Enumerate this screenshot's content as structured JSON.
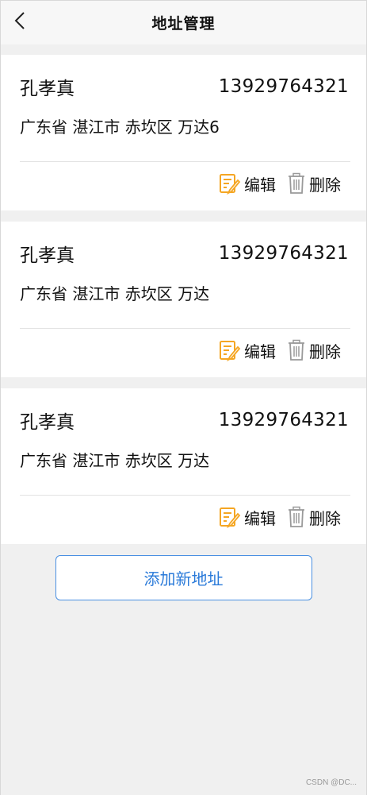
{
  "header": {
    "title": "地址管理",
    "back_icon": "chevron-left-icon"
  },
  "addresses": [
    {
      "name": "孔孝真",
      "phone": "13929764321",
      "address": "广东省 湛江市 赤坎区 万达6",
      "edit_label": "编辑",
      "delete_label": "删除"
    },
    {
      "name": "孔孝真",
      "phone": "13929764321",
      "address": "广东省 湛江市 赤坎区 万达",
      "edit_label": "编辑",
      "delete_label": "删除"
    },
    {
      "name": "孔孝真",
      "phone": "13929764321",
      "address": "广东省 湛江市 赤坎区 万达",
      "edit_label": "编辑",
      "delete_label": "删除"
    }
  ],
  "add_button": {
    "label": "添加新地址"
  },
  "watermark": "CSDN @DC...",
  "colors": {
    "accent_blue": "#2a7ad9",
    "edit_icon": "#f5a623",
    "delete_icon": "#9a9a9a",
    "background": "#f0f0f0"
  }
}
